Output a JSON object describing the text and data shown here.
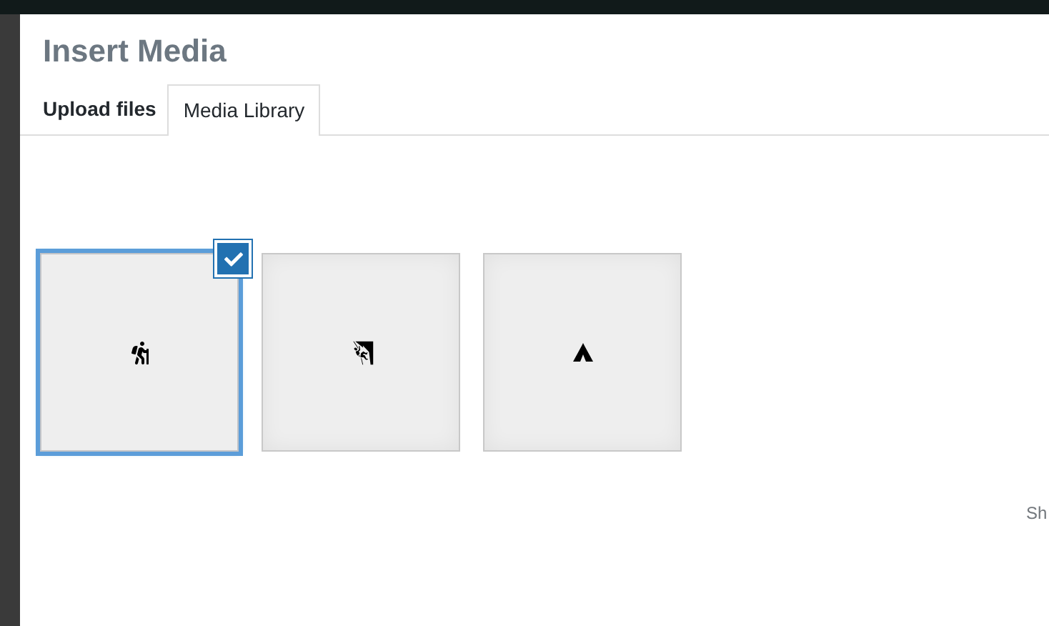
{
  "dialog": {
    "title": "Insert Media",
    "tabs": [
      {
        "label": "Upload files",
        "selected": false
      },
      {
        "label": "Media Library",
        "selected": true
      }
    ],
    "attachments": [
      {
        "kind": "hiker",
        "selected": true
      },
      {
        "kind": "climber",
        "selected": false
      },
      {
        "kind": "tent",
        "selected": false
      }
    ],
    "sidebar_text": "Sh"
  }
}
